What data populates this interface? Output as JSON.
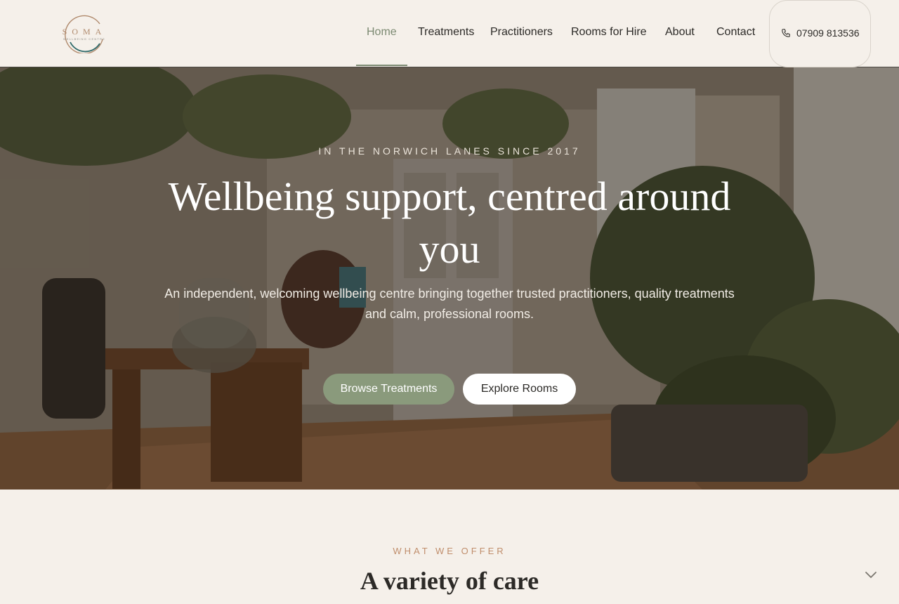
{
  "brand": {
    "logo_text": "SOMA",
    "logo_sub": "WELLBEING CENTRE"
  },
  "nav": {
    "items": [
      {
        "label": "Home",
        "active": true
      },
      {
        "label": "Treatments"
      },
      {
        "label": "Practitioners"
      },
      {
        "label": "Rooms for Hire"
      },
      {
        "label": "About"
      },
      {
        "label": "Contact"
      }
    ],
    "phone": "07909 813536",
    "phone_icon": "phone-icon"
  },
  "hero": {
    "eyebrow": "IN THE NORWICH LANES SINCE 2017",
    "title": "Wellbeing support, centred around you",
    "subtitle": "An independent, welcoming wellbeing centre bringing together trusted practitioners, quality treatments and calm, professional rooms.",
    "primary_cta": "Browse Treatments",
    "secondary_cta": "Explore Rooms"
  },
  "offer": {
    "eyebrow": "WHAT WE OFFER",
    "title": "A variety of care"
  },
  "colors": {
    "accent_green": "#8a9a7c",
    "accent_terracotta": "#c08e6c",
    "background": "#f5f0ea",
    "text": "#2c2a27"
  }
}
